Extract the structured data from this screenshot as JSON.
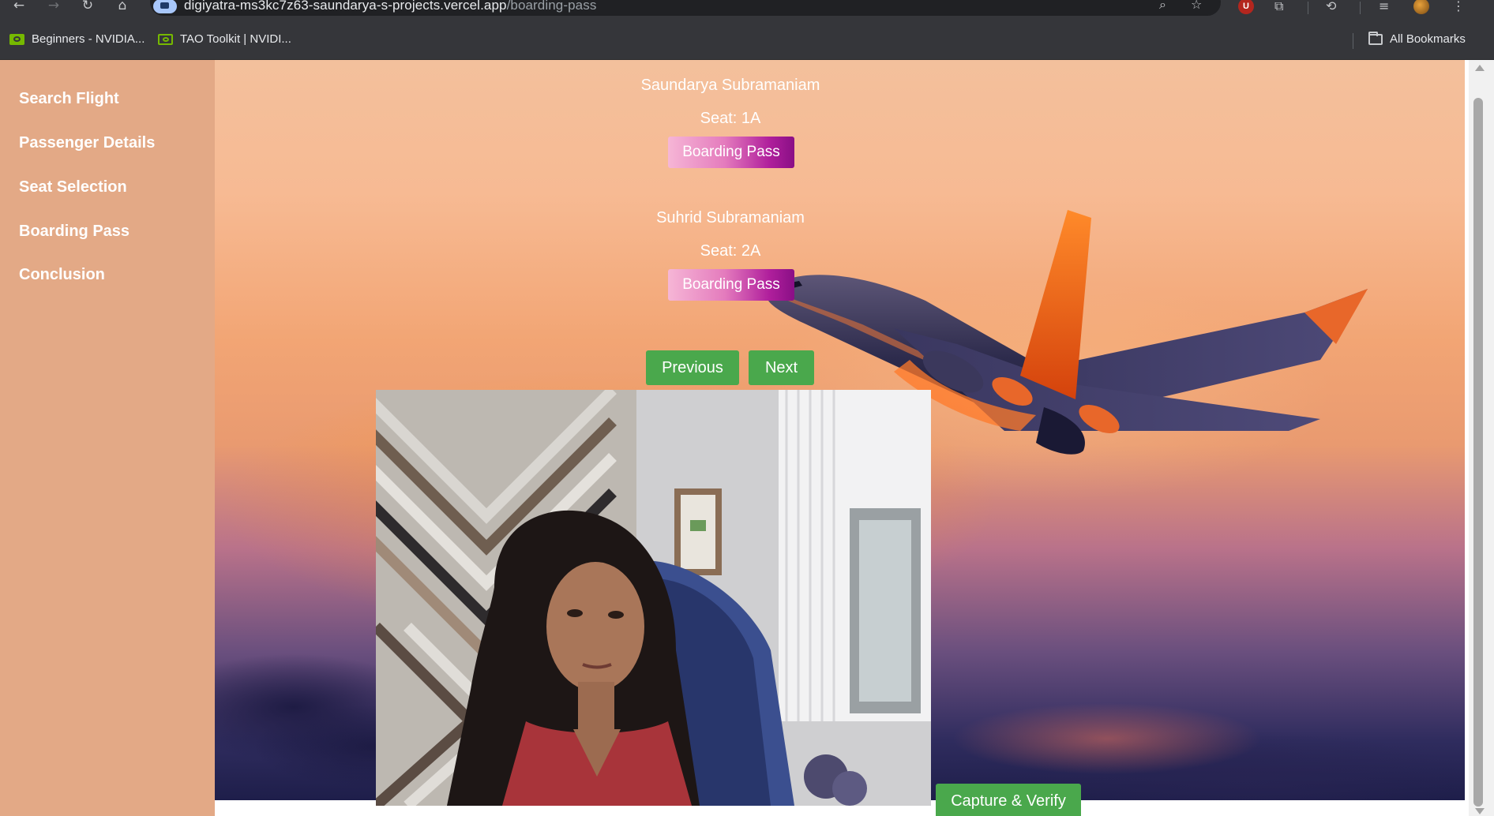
{
  "browser": {
    "url_host": "digiyatra-ms3kc7z63-saundarya-s-projects.vercel.app",
    "url_path": "/boarding-pass",
    "icons": {
      "back": "back-arrow-icon",
      "forward": "forward-arrow-icon",
      "reload": "reload-icon",
      "home": "home-icon",
      "zoom": "zoom-icon",
      "bookmark": "star-icon",
      "menu": "kebab-menu-icon"
    },
    "bookmarks": [
      {
        "label": "Beginners - NVIDIA...",
        "icon": "nvidia-icon"
      },
      {
        "label": "TAO Toolkit | NVIDI...",
        "icon": "nvidia-icon"
      }
    ],
    "all_bookmarks_label": "All Bookmarks",
    "extension_badge": "U"
  },
  "sidebar": {
    "items": [
      {
        "label": "Search Flight"
      },
      {
        "label": "Passenger Details"
      },
      {
        "label": "Seat Selection"
      },
      {
        "label": "Boarding Pass"
      },
      {
        "label": "Conclusion"
      }
    ],
    "background_color": "#e3a986"
  },
  "main": {
    "passengers": [
      {
        "name": "Saundarya Subramaniam",
        "seat": "Seat: 1A",
        "button_label": "Boarding Pass"
      },
      {
        "name": "Suhrid Subramaniam",
        "seat": "Seat: 2A",
        "button_label": "Boarding Pass"
      }
    ],
    "previous_label": "Previous",
    "next_label": "Next",
    "capture_label": "Capture & Verify",
    "accent_green": "#4aa84c"
  }
}
